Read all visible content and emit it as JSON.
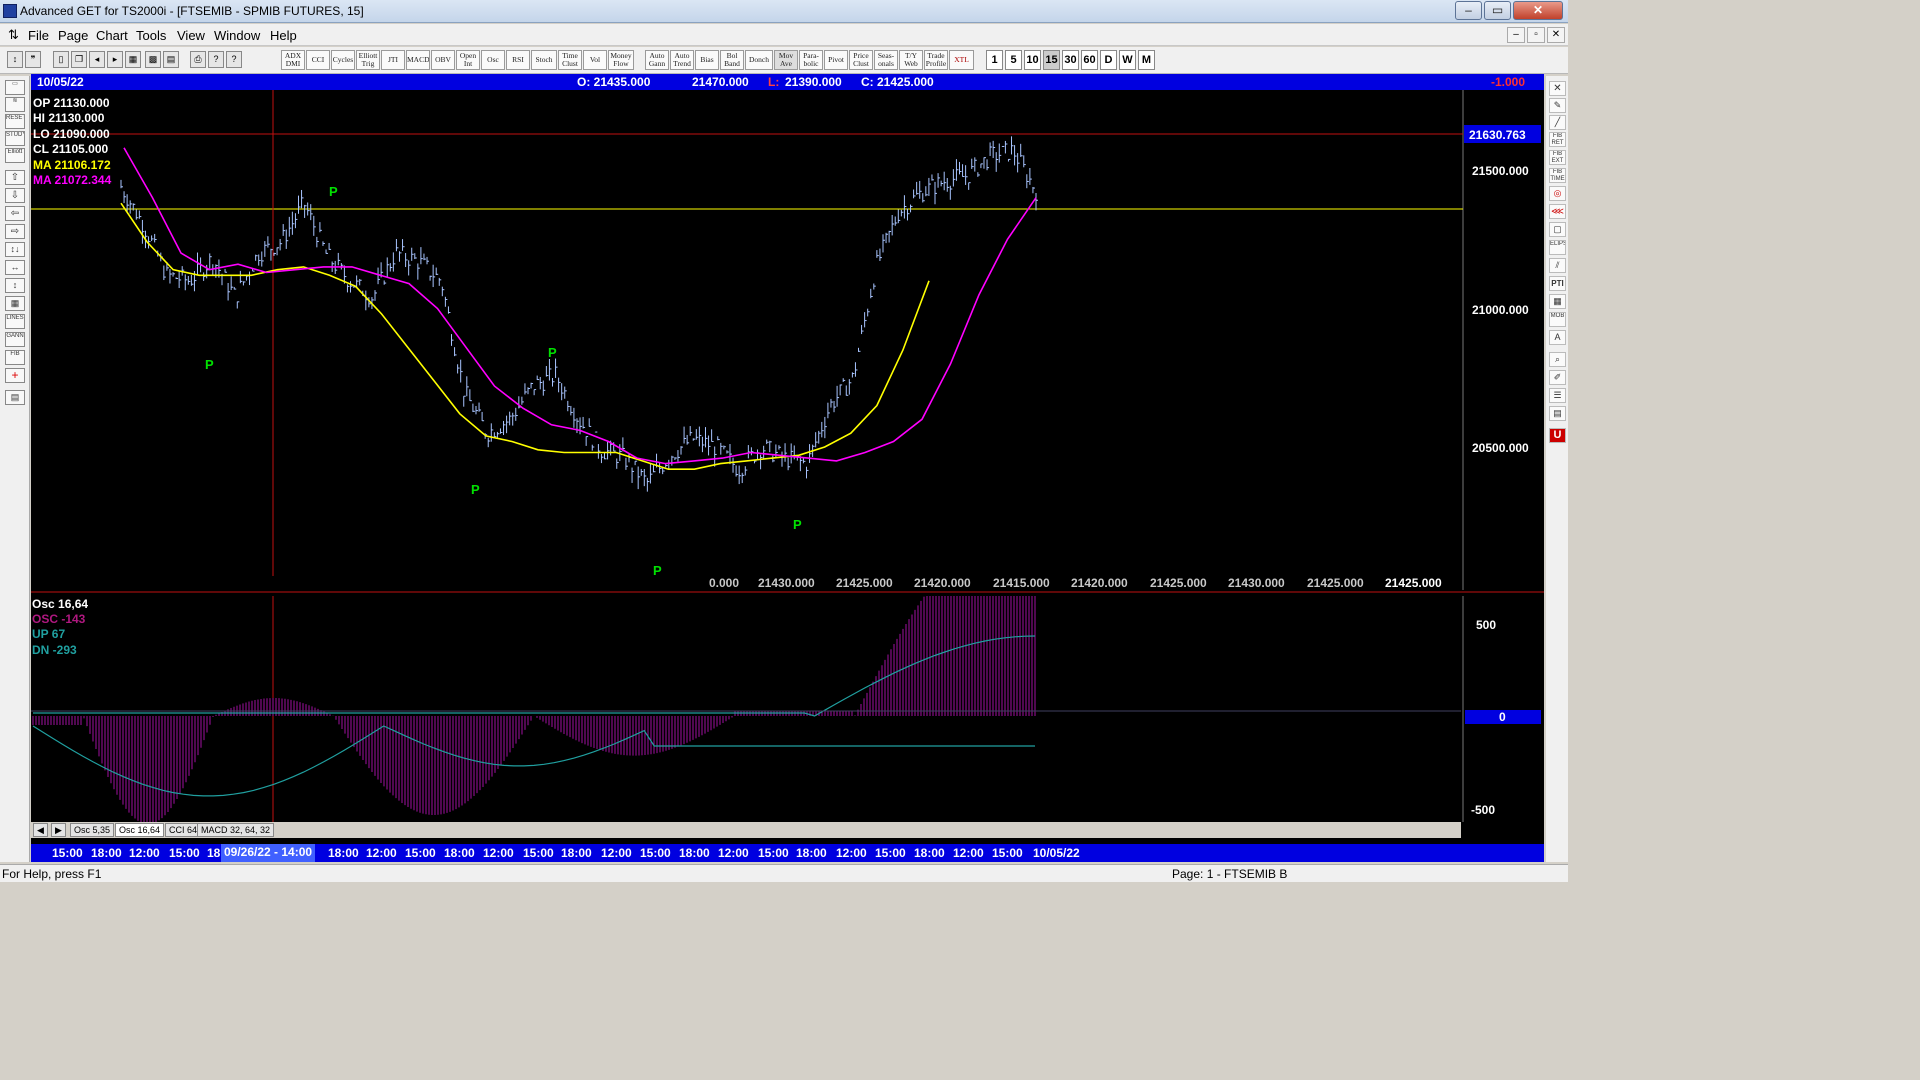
{
  "window": {
    "title": "Advanced GET for TS2000i - [FTSEMIB - SPMIB FUTURES, 15]"
  },
  "menu": [
    "File",
    "Page",
    "Chart",
    "Tools",
    "View",
    "Window",
    "Help"
  ],
  "toolbar": {
    "studies": [
      "ADX DMI",
      "CCI",
      "Cycles",
      "Elliott Trig",
      "JTI",
      "MACD",
      "OBV",
      "Open Int",
      "Osc",
      "RSI",
      "Stoch",
      "Time Clust",
      "Vol",
      "Money Flow",
      "Auto Gann",
      "Auto Trend",
      "Bias",
      "Bol Band",
      "Donch",
      "Mov Ave",
      "Para-bolic",
      "Pivot",
      "Price Clust",
      "Seas-onals",
      "T/Y Web",
      "Trade Profile",
      "XTL"
    ],
    "intervals": [
      "1",
      "5",
      "10",
      "15",
      "30",
      "60",
      "D",
      "W",
      "M"
    ]
  },
  "header": {
    "date": "10/05/22",
    "open": "O: 21435.000",
    "high": "21470.000",
    "low_label": "L:",
    "low": "21390.000",
    "close": "C: 21425.000",
    "change": "-1.000"
  },
  "price_box": {
    "op": "OP  21130.000",
    "hi": "HI  21130.000",
    "lo": "LO  21090.000",
    "cl": "CL  21105.000",
    "ma1": "MA  21106.172",
    "ma2": "MA  21072.344"
  },
  "price_axis": {
    "marker": "21630.763",
    "ticks": [
      "21500.000",
      "21000.000",
      "20500.000"
    ]
  },
  "bottom_values": [
    "0.000",
    "21430.000",
    "21425.000",
    "21420.000",
    "21415.000",
    "21420.000",
    "21425.000",
    "21430.000",
    "21425.000",
    "21425.000"
  ],
  "pivots": [
    "P",
    "P",
    "P",
    "P",
    "P",
    "P",
    "P"
  ],
  "osc": {
    "title": "Osc 16,64",
    "osc": "OSC -143",
    "up": "UP   67",
    "dn": "DN   -293",
    "ticks": [
      "500",
      "0",
      "-500"
    ]
  },
  "tabs": [
    "Osc 5,35",
    "Osc 16,64",
    "CCI 64",
    "MACD 32, 64, 32"
  ],
  "time_axis": [
    "15:00",
    "18:00",
    "12:00",
    "15:00",
    "18",
    "09/26/22 - 14:00",
    "18:00",
    "12:00",
    "15:00",
    "18:00",
    "12:00",
    "15:00",
    "18:00",
    "12:00",
    "15:00",
    "18:00",
    "12:00",
    "15:00",
    "18:00",
    "12:00",
    "15:00",
    "18:00",
    "12:00",
    "15:00",
    "10/05/22"
  ],
  "status": {
    "left": "For Help, press F1",
    "right": "Page: 1 - FTSEMIB B"
  },
  "colors": {
    "chart_bg": "#000000",
    "bars": "#a8c4ff",
    "ma_fast": "#ffff00",
    "ma_slow": "#ff00ff",
    "pivot": "#00ff00",
    "osc_hist": "#b000b0",
    "osc_line": "#20a0a0",
    "title_blue": "#0000e0"
  },
  "chart_data": {
    "type": "line",
    "title": "FTSEMIB - SPMIB FUTURES, 15",
    "series": [
      {
        "values": [
          21440,
          21300,
          21120,
          21100,
          21180,
          21040,
          21200,
          21240,
          21380,
          21190,
          21100,
          21040,
          21200,
          21170,
          21100,
          20700,
          20550,
          20600,
          20720,
          20760,
          20600,
          20490,
          20460,
          20370,
          20470,
          20530,
          20500,
          20420,
          20500,
          20460,
          20440,
          20650,
          20750,
          21150,
          21350,
          21420,
          21460,
          21480,
          21550,
          21570,
          21425
        ]
      },
      {
        "values": [
          21380,
          21240,
          21140,
          21120,
          21120,
          21120,
          21140,
          21150,
          21120,
          21080,
          20980,
          20860,
          20740,
          20620,
          20540,
          20520,
          20490,
          20480,
          20480,
          20480,
          20450,
          20420,
          20420,
          20440,
          20450,
          20460,
          20470,
          20500,
          20550,
          20650,
          20850,
          21100
        ]
      },
      {
        "values": [
          21580,
          21400,
          21200,
          21140,
          21160,
          21130,
          21140,
          21150,
          21150,
          21120,
          21090,
          21000,
          20860,
          20720,
          20640,
          20580,
          20560,
          20520,
          20460,
          20440,
          20450,
          20460,
          20480,
          20470,
          20460,
          20450,
          20480,
          20520,
          20600,
          20800,
          21050,
          21250,
          21400
        ]
      }
    ]
  }
}
